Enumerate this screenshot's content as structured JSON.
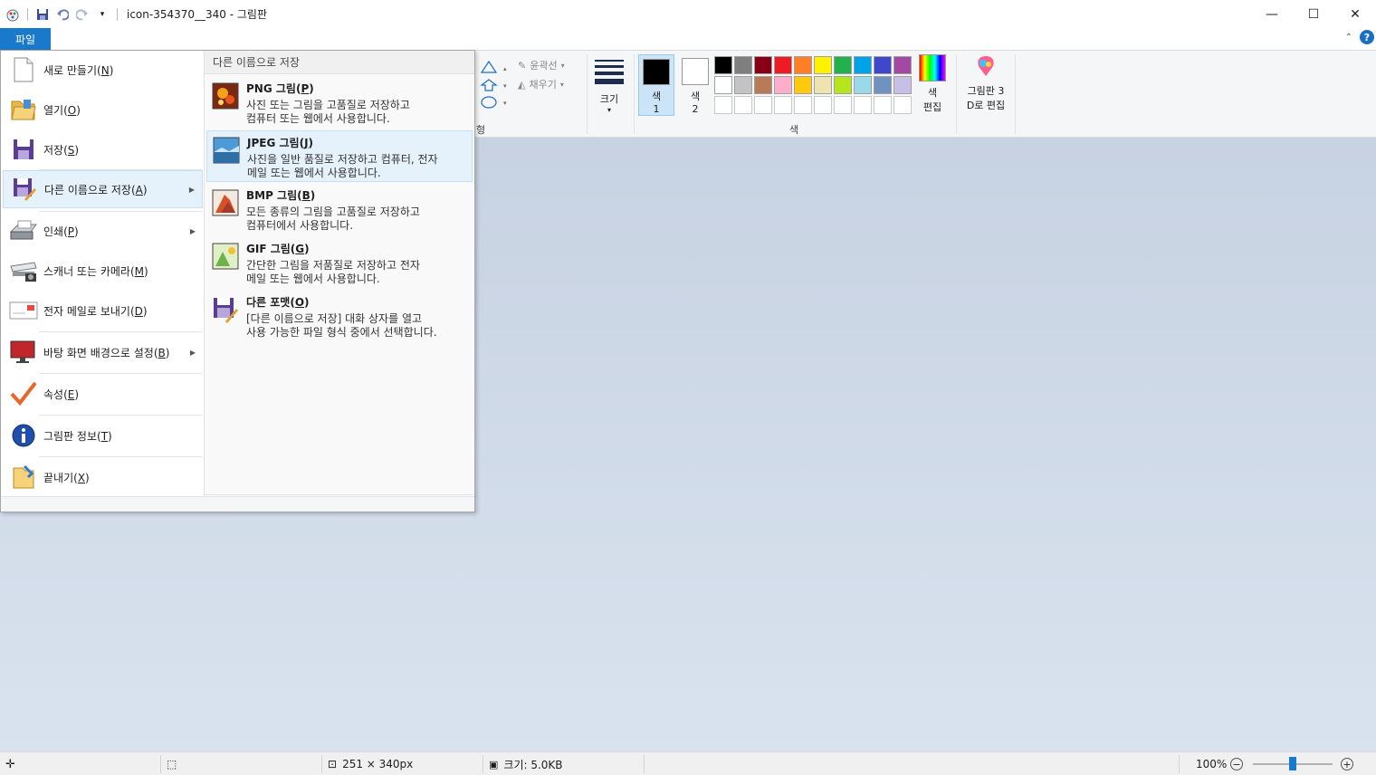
{
  "window": {
    "title": "icon-354370__340 - 그림판",
    "minimize": "—",
    "maximize": "☐",
    "close": "✕"
  },
  "ribbon": {
    "file_tab": "파일",
    "outline_label": "윤곽선",
    "fill_label": "채우기",
    "shapes_group_label_fragment": "형",
    "size_label": "크기",
    "color1_label": "색",
    "color1_num": "1",
    "color2_label": "색",
    "color2_num": "2",
    "edit_colors_l1": "색",
    "edit_colors_l2": "편집",
    "paint3d_l1": "그림판 3",
    "paint3d_l2": "D로 편집",
    "colors_group_label": "색",
    "help": "?",
    "colors": {
      "color1": "#000000",
      "color2": "#ffffff",
      "palette": [
        "#000000",
        "#7f7f7f",
        "#880015",
        "#ed1c24",
        "#ff7f27",
        "#fff200",
        "#22b14c",
        "#00a2e8",
        "#3f48cc",
        "#a349a4",
        "#ffffff",
        "#c3c3c3",
        "#b97a57",
        "#ffaec9",
        "#ffc90e",
        "#efe4b0",
        "#b5e61d",
        "#99d9ea",
        "#7092be",
        "#c8bfe7",
        "#ffffff",
        "#ffffff",
        "#ffffff",
        "#ffffff",
        "#ffffff",
        "#ffffff",
        "#ffffff",
        "#ffffff",
        "#ffffff",
        "#ffffff"
      ]
    }
  },
  "file_menu": {
    "items": [
      {
        "label": "새로 만들기",
        "key": "N",
        "icon": "new-file-icon"
      },
      {
        "label": "열기",
        "key": "O",
        "icon": "open-folder-icon"
      },
      {
        "label": "저장",
        "key": "S",
        "icon": "save-icon"
      },
      {
        "label": "다른 이름으로 저장",
        "key": "A",
        "icon": "save-as-icon"
      },
      {
        "label": "인쇄",
        "key": "P",
        "icon": "printer-icon"
      },
      {
        "label": "스캐너 또는 카메라",
        "key": "M",
        "icon": "scanner-icon"
      },
      {
        "label": "전자 메일로 보내기",
        "key": "D",
        "icon": "email-icon"
      },
      {
        "label": "바탕 화면 배경으로 설정",
        "key": "B",
        "icon": "desktop-icon"
      },
      {
        "label": "속성",
        "key": "E",
        "icon": "checkmark-icon"
      },
      {
        "label": "그림판 정보",
        "key": "T",
        "icon": "info-icon"
      },
      {
        "label": "끝내기",
        "key": "X",
        "icon": "exit-icon"
      }
    ],
    "submenu": {
      "header": "다른 이름으로 저장",
      "items": [
        {
          "title": "PNG 그림",
          "key": "P",
          "desc": "사진 또는 그림을 고품질로 저장하고\n컴퓨터 또는 웹에서 사용합니다.",
          "icon": "png-icon"
        },
        {
          "title": "JPEG 그림",
          "key": "J",
          "desc": "사진을 일반 품질로 저장하고 컴퓨터, 전자\n메일 또는 웹에서 사용합니다.",
          "icon": "jpeg-icon"
        },
        {
          "title": "BMP 그림",
          "key": "B",
          "desc": "모든 종류의 그림을 고품질로 저장하고\n컴퓨터에서 사용합니다.",
          "icon": "bmp-icon"
        },
        {
          "title": "GIF 그림",
          "key": "G",
          "desc": "간단한 그림을 저품질로 저장하고 전자\n메일 또는 웹에서 사용합니다.",
          "icon": "gif-icon"
        },
        {
          "title": "다른 포맷",
          "key": "O",
          "desc": "[다른 이름으로 저장] 대화 상자를 열고\n사용 가능한 파일 형식 중에서 선택합니다.",
          "icon": "other-format-icon"
        }
      ]
    }
  },
  "statusbar": {
    "dimensions": "251 × 340px",
    "size": "크기: 5.0KB",
    "zoom": "100%",
    "zoom_fraction": 0.5
  }
}
